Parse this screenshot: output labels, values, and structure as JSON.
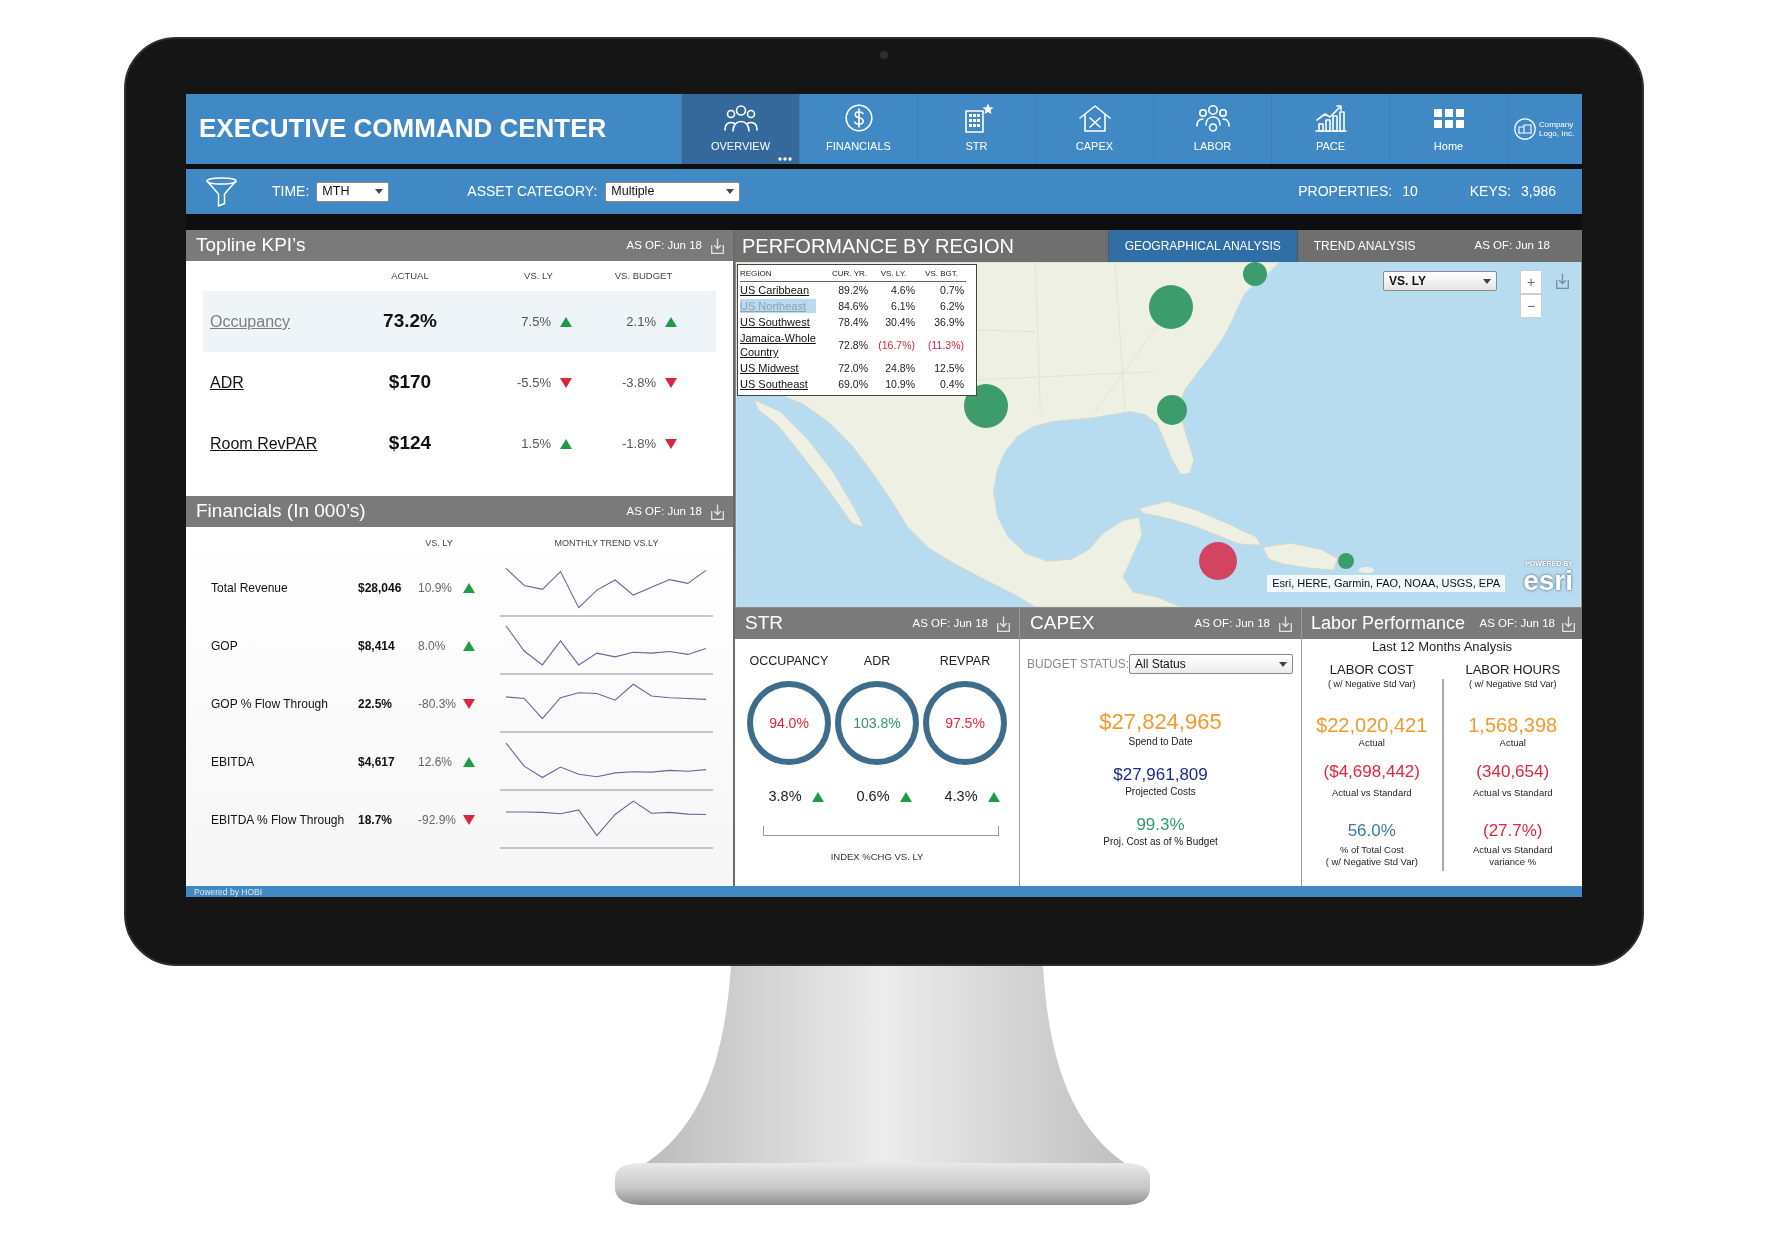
{
  "header": {
    "title": "EXECUTIVE COMMAND CENTER",
    "nav": [
      {
        "label": "OVERVIEW",
        "selected": true
      },
      {
        "label": "FINANCIALS",
        "selected": false
      },
      {
        "label": "STR",
        "selected": false
      },
      {
        "label": "CAPEX",
        "selected": false
      },
      {
        "label": "LABOR",
        "selected": false
      },
      {
        "label": "PACE",
        "selected": false
      },
      {
        "label": "Home",
        "selected": false
      }
    ],
    "logo": "Company Logo, Inc."
  },
  "filters": {
    "time": {
      "label": "TIME:",
      "value": "MTH"
    },
    "asset_category": {
      "label": "ASSET CATEGORY:",
      "value": "Multiple"
    },
    "properties": {
      "label": "PROPERTIES:",
      "value": "10"
    },
    "keys": {
      "label": "KEYS:",
      "value": "3,986"
    }
  },
  "topline_kpis": {
    "title": "Topline KPI’s",
    "as_of": "AS OF: Jun 18",
    "columns": [
      "ACTUAL",
      "VS. LY",
      "VS. BUDGET"
    ],
    "rows": [
      {
        "name": "Occupancy",
        "selected": true,
        "actual": "73.2%",
        "vs_ly": "7.5%",
        "vs_ly_up": true,
        "vs_budget": "2.1%",
        "vs_budget_up": true
      },
      {
        "name": "ADR",
        "selected": false,
        "actual": "$170",
        "vs_ly": "-5.5%",
        "vs_ly_up": false,
        "vs_budget": "-3.8%",
        "vs_budget_up": false
      },
      {
        "name": "Room RevPAR",
        "selected": false,
        "actual": "$124",
        "vs_ly": "1.5%",
        "vs_ly_up": true,
        "vs_budget": "-1.8%",
        "vs_budget_up": false
      }
    ]
  },
  "financials": {
    "title": "Financials (In 000’s)",
    "as_of": "AS OF: Jun 18",
    "columns": [
      "VS. LY",
      "MONTHLY TREND VS.LY"
    ],
    "rows": [
      {
        "name": "Total Revenue",
        "value": "$28,046",
        "vs_ly": "10.9%",
        "up": true
      },
      {
        "name": "GOP",
        "value": "$8,414",
        "vs_ly": "8.0%",
        "up": true
      },
      {
        "name": "GOP % Flow Through",
        "value": "22.5%",
        "vs_ly": "-80.3%",
        "up": false
      },
      {
        "name": "EBITDA",
        "value": "$4,617",
        "vs_ly": "12.6%",
        "up": true
      },
      {
        "name": "EBITDA % Flow Through",
        "value": "18.7%",
        "vs_ly": "-92.9%",
        "up": false
      }
    ]
  },
  "performance_by_region": {
    "title": "PERFORMANCE BY REGION",
    "tabs": [
      {
        "label": "GEOGRAPHICAL ANALYSIS",
        "selected": true
      },
      {
        "label": "TREND ANALYSIS",
        "selected": false
      }
    ],
    "as_of": "AS OF: Jun 18",
    "region_table": {
      "columns": [
        "REGION",
        "CUR. YR.",
        "VS. LY.",
        "VS. BGT."
      ],
      "rows": [
        {
          "region": "US Caribbean",
          "selected": false,
          "cur_yr": "89.2%",
          "vs_ly": "4.6%",
          "vs_ly_negative": false,
          "vs_bgt": "0.7%",
          "vs_bgt_negative": false
        },
        {
          "region": "US Northeast",
          "selected": true,
          "cur_yr": "84.6%",
          "vs_ly": "6.1%",
          "vs_ly_negative": false,
          "vs_bgt": "6.2%",
          "vs_bgt_negative": false
        },
        {
          "region": "US Southwest",
          "selected": false,
          "cur_yr": "78.4%",
          "vs_ly": "30.4%",
          "vs_ly_negative": false,
          "vs_bgt": "36.9%",
          "vs_bgt_negative": false
        },
        {
          "region": "Jamaica-Whole Country",
          "selected": false,
          "cur_yr": "72.8%",
          "vs_ly": "(16.7%)",
          "vs_ly_negative": true,
          "vs_bgt": "(11.3%)",
          "vs_bgt_negative": true
        },
        {
          "region": "US Midwest",
          "selected": false,
          "cur_yr": "72.0%",
          "vs_ly": "24.8%",
          "vs_ly_negative": false,
          "vs_bgt": "12.5%",
          "vs_bgt_negative": false
        },
        {
          "region": "US Southeast",
          "selected": false,
          "cur_yr": "69.0%",
          "vs_ly": "10.9%",
          "vs_ly_negative": false,
          "vs_bgt": "0.4%",
          "vs_bgt_negative": false
        }
      ]
    },
    "map": {
      "compare_select": "VS. LY",
      "zoom_in": "+",
      "zoom_out": "−",
      "markers": [
        {
          "color": "#3d9c6b"
        },
        {
          "color": "#3d9c6b"
        },
        {
          "color": "#3d9c6b"
        },
        {
          "color": "#3d9c6b"
        },
        {
          "color": "#d2445f"
        },
        {
          "color": "#3d9c6b"
        }
      ],
      "attribution": "Esri, HERE, Garmin, FAO, NOAA, USGS, EPA",
      "logo_caption": "POWERED BY",
      "logo_text": "esri"
    }
  },
  "str": {
    "title": "STR",
    "as_of": "AS OF: Jun 18",
    "metrics": [
      {
        "label": "OCCUPANCY",
        "index": "94.0%",
        "index_negative": true,
        "change": "3.8%",
        "up": true
      },
      {
        "label": "ADR",
        "index": "103.8%",
        "index_negative": false,
        "change": "0.6%",
        "up": true
      },
      {
        "label": "REVPAR",
        "index": "97.5%",
        "index_negative": true,
        "change": "4.3%",
        "up": true
      }
    ],
    "caption": "INDEX %CHG VS. LY"
  },
  "capex": {
    "title": "CAPEX",
    "as_of": "AS OF: Jun 18",
    "filter_label": "BUDGET STATUS:",
    "filter_value": "All Status",
    "figures": [
      {
        "value": "$27,824,965",
        "caption": "Spend to Date",
        "color": "#f39a2b"
      },
      {
        "value": "$27,961,809",
        "caption": "Projected Costs",
        "color": "#1b2a85"
      },
      {
        "value": "99.3%",
        "caption": "Proj. Cost as of % Budget",
        "color": "#2e9b6b"
      }
    ]
  },
  "labor_performance": {
    "title": "Labor Performance",
    "as_of": "AS OF: Jun 18",
    "subtitle": "Last 12 Months Analysis",
    "columns": [
      {
        "heading": "LABOR COST",
        "subheading": "( w/ Negative Std Var)",
        "figures": [
          {
            "value": "$22,020,421",
            "caption": "Actual",
            "color": "#f39a2b"
          },
          {
            "value": "($4,698,442)",
            "caption": "Actual vs Standard",
            "color": "#e3253b"
          },
          {
            "value": "56.0%",
            "caption": "% of Total Cost\n( w/ Negative Std Var)",
            "color": "#3b79a6"
          }
        ]
      },
      {
        "heading": "LABOR HOURS",
        "subheading": "( w/ Negative Std Var)",
        "figures": [
          {
            "value": "1,568,398",
            "caption": "Actual",
            "color": "#f39a2b"
          },
          {
            "value": "(340,654)",
            "caption": "Actual vs Standard",
            "color": "#e3253b"
          },
          {
            "value": "(27.7%)",
            "caption": "Actual vs Standard\nvariance %",
            "color": "#e3253b"
          }
        ]
      }
    ]
  },
  "footer": "Powered by HOBI"
}
